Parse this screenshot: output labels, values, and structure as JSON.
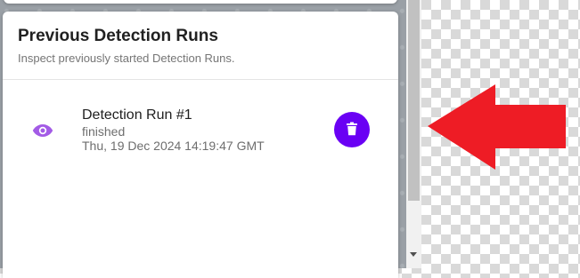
{
  "panel": {
    "title": "Previous Detection Runs",
    "subtitle": "Inspect previously started Detection Runs."
  },
  "runs": [
    {
      "name": "Detection Run #1",
      "status": "finished",
      "date": "Thu, 19 Dec 2024 14:19:47 GMT",
      "view_icon": "eye-icon",
      "delete_icon": "trash-icon"
    }
  ],
  "colors": {
    "accent": "#6a00f4",
    "view_icon": "#a35be6",
    "annotation_arrow": "#ee1c25"
  },
  "annotation": {
    "icon": "left-arrow"
  }
}
